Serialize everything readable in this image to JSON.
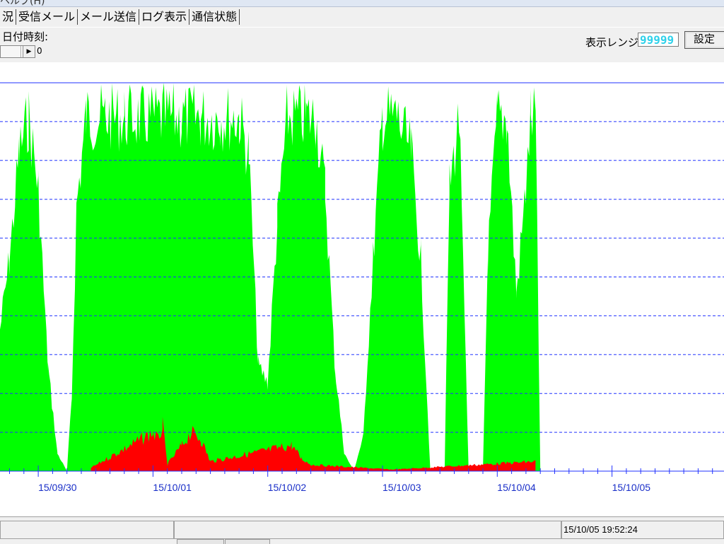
{
  "window": {
    "title": "ヘルプ(H)"
  },
  "tabs": [
    {
      "label": "況"
    },
    {
      "label": "受信メール"
    },
    {
      "label": "メール送信"
    },
    {
      "label": "ログ表示"
    },
    {
      "label": "通信状態"
    }
  ],
  "toolbar": {
    "date_label": "日付時刻:",
    "scroll_value": "0",
    "scroll_arrow_icon": "right-arrow-icon",
    "range_label": "表示レンジ:",
    "range_value": "99999",
    "set_label": "設定"
  },
  "status": {
    "timestamp": "15/10/05 19:52:24"
  },
  "colors": {
    "series_main": "#00ff00",
    "series_error": "#ff0000",
    "grid": "#2233ff",
    "axis": "#2233ff",
    "tick_label": "#1a2fc8",
    "range_text": "#2fd1ea"
  },
  "chart_data": {
    "type": "area",
    "x_tick_labels": [
      "15/09/30",
      "15/10/01",
      "15/10/02",
      "15/10/03",
      "15/10/04",
      "15/10/05"
    ],
    "x_range": [
      "15/09/29 16:00",
      "15/10/05 19:52"
    ],
    "ylim": [
      0,
      99999
    ],
    "grid": true,
    "gridlines_y": 10,
    "series": [
      {
        "values_note": "",
        "points": [
          [
            "15/09/29 16:00",
            40000
          ],
          [
            "15/09/29 18:00",
            60000
          ],
          [
            "15/09/29 20:00",
            90000
          ],
          [
            "15/09/29 22:00",
            100000
          ],
          [
            "15/09/30 00:00",
            80000
          ],
          [
            "15/09/30 02:00",
            30000
          ],
          [
            "15/09/30 04:00",
            5000
          ],
          [
            "15/09/30 06:00",
            0
          ],
          [
            "15/09/30 07:00",
            20000
          ],
          [
            "15/09/30 08:00",
            75000
          ],
          [
            "15/09/30 10:00",
            100000
          ],
          [
            "15/09/30 14:00",
            100000
          ],
          [
            "15/09/30 18:00",
            100000
          ],
          [
            "15/09/30 22:00",
            100000
          ],
          [
            "15/10/01 02:00",
            100000
          ],
          [
            "15/10/01 06:00",
            100000
          ],
          [
            "15/10/01 10:00",
            100000
          ],
          [
            "15/10/01 14:00",
            100000
          ],
          [
            "15/10/01 18:00",
            100000
          ],
          [
            "15/10/01 20:00",
            90000
          ],
          [
            "15/10/01 22:00",
            30000
          ],
          [
            "15/10/02 00:00",
            25000
          ],
          [
            "15/10/02 02:00",
            70000
          ],
          [
            "15/10/02 04:00",
            100000
          ],
          [
            "15/10/02 08:00",
            100000
          ],
          [
            "15/10/02 10:00",
            100000
          ],
          [
            "15/10/02 12:00",
            80000
          ],
          [
            "15/10/02 14:00",
            30000
          ],
          [
            "15/10/02 16:00",
            5000
          ],
          [
            "15/10/02 18:00",
            0
          ],
          [
            "15/10/02 20:00",
            10000
          ],
          [
            "15/10/02 22:00",
            60000
          ],
          [
            "15/10/03 00:00",
            100000
          ],
          [
            "15/10/03 03:00",
            100000
          ],
          [
            "15/10/03 06:00",
            90000
          ],
          [
            "15/10/03 08:00",
            60000
          ],
          [
            "15/10/03 10:00",
            0
          ],
          [
            "15/10/03 13:00",
            0
          ],
          [
            "15/10/03 14:00",
            80000
          ],
          [
            "15/10/03 16:00",
            100000
          ],
          [
            "15/10/03 18:00",
            0
          ],
          [
            "15/10/03 21:00",
            0
          ],
          [
            "15/10/03 22:00",
            60000
          ],
          [
            "15/10/04 00:00",
            100000
          ],
          [
            "15/10/04 02:00",
            100000
          ],
          [
            "15/10/04 04:00",
            50000
          ],
          [
            "15/10/04 06:00",
            80000
          ],
          [
            "15/10/04 07:00",
            100000
          ],
          [
            "15/10/04 08:00",
            100000
          ],
          [
            "15/10/04 09:00",
            0
          ],
          [
            "15/10/05 19:52",
            0
          ]
        ]
      },
      {
        "values_note": "",
        "points": [
          [
            "15/09/30 11:00",
            1000
          ],
          [
            "15/10/01 00:00",
            12000
          ],
          [
            "15/10/01 01:00",
            10000
          ],
          [
            "15/10/01 02:00",
            14000
          ],
          [
            "15/10/01 03:00",
            2000
          ],
          [
            "15/10/01 06:00",
            8000
          ],
          [
            "15/10/01 08:00",
            12000
          ],
          [
            "15/10/01 10:00",
            10000
          ],
          [
            "15/10/01 12:00",
            3000
          ],
          [
            "15/10/02 05:00",
            8000
          ],
          [
            "15/10/02 07:00",
            4000
          ],
          [
            "15/10/02 09:00",
            2000
          ],
          [
            "15/10/03 02:00",
            500
          ],
          [
            "15/10/04 08:00",
            3000
          ]
        ]
      }
    ]
  }
}
